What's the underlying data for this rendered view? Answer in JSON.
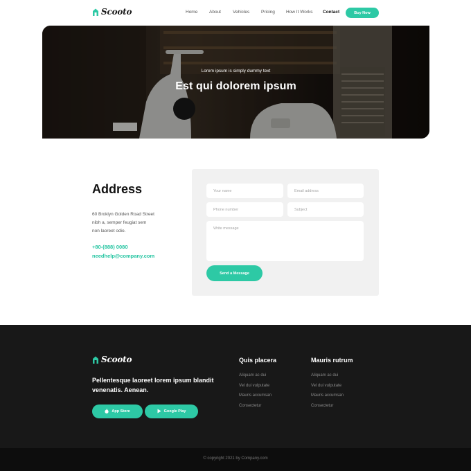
{
  "brand": {
    "name": "Scooto",
    "accent": "#2dc9a5"
  },
  "nav": {
    "items": [
      {
        "label": "Home"
      },
      {
        "label": "About"
      },
      {
        "label": "Vehicles"
      },
      {
        "label": "Pricing"
      },
      {
        "label": "How It Works"
      },
      {
        "label": "Contact"
      }
    ],
    "active": "Contact",
    "cta": "Buy Now"
  },
  "hero": {
    "subtitle": "Lorem ipsum is simply dummy text",
    "title": "Est qui dolorem ipsum"
  },
  "address": {
    "title": "Address",
    "lines": [
      "60 Broklyn Golden Road Street",
      "nibh a, semper feugiat sem",
      "non laoreet odio."
    ],
    "phone": "+80-(888) 0080",
    "email": "needhelp@company.com"
  },
  "form": {
    "name_placeholder": "Your name",
    "email_placeholder": "Email address",
    "phone_placeholder": "Phone number",
    "subject_placeholder": "Subject",
    "message_placeholder": "Write message",
    "submit": "Send a Message"
  },
  "footer": {
    "tagline": "Pellentesque laoreet lorem ipsum blandit venenatis. Aenean.",
    "app_store": "App Store",
    "google_play": "Google Play",
    "col1": {
      "title": "Quis placera",
      "links": [
        "Aliquam ac dui",
        "Vel dui vulputate",
        "Mauris accumsan",
        "Consectetur"
      ]
    },
    "col2": {
      "title": "Mauris rutrum",
      "links": [
        "Aliquam ac dui",
        "Vel dui vulputate",
        "Mauris accumsan",
        "Consectetur"
      ]
    },
    "copyright": "© copyright 2021 by Company.com"
  }
}
